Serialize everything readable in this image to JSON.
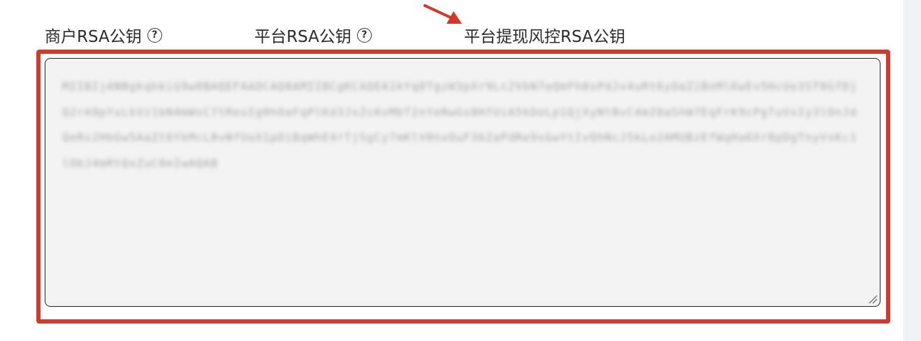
{
  "tabs": [
    {
      "label": "商户RSA公钥",
      "help": "?"
    },
    {
      "label": "平台RSA公钥",
      "help": "?"
    },
    {
      "label": "平台提现风控RSA公钥"
    }
  ],
  "annotation": {
    "arrow_color": "#d0392b",
    "box_color": "#d0392b"
  },
  "public_key_field": {
    "value": "MIIBIjANBgkqhkiG9w0BAQEFAAOCAQ8AMIIBCgKCAQEA1kYq8TgzW3pXr9Lc2VbN7eQmFh0sPdJx4uRt6yOaZiBnMlKwEv5HcUo3ST8GfDjQ2rA9pYxLkVz1bN4mWsC7tReuIg0hOaFqPlKd3JxZc6vMbT2nYeRwGs8HfUiA5kDoLp1QjXyNtBvC4mZ0aShW7EqFrK9cPgTuVxIy3lOnJdQeRs2HbGw5AaZt6YkMcL8vNfUoX1pDiBqWhE4rTjSgCy7mKlV0nxOuF3bZaPdRe9sGwYtIvQhNcJ5kLo2AMUBzEfWqHa6Xr8pDgTnyVsKc1lObJ4mRtQxZuC0eIwAQAB"
  }
}
